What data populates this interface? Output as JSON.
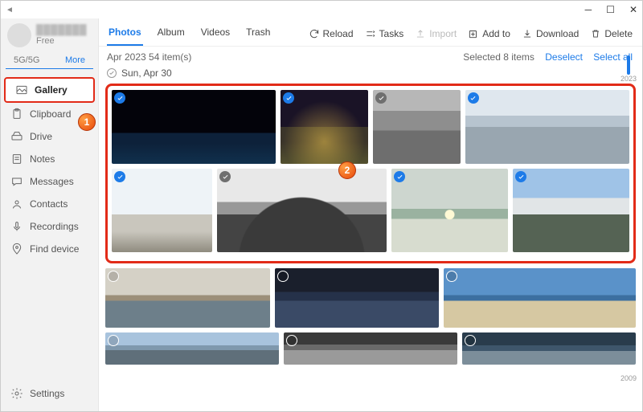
{
  "titlebar": {
    "sound_icon": "◄"
  },
  "user": {
    "name_placeholder": "███████",
    "plan": "Free",
    "network": "5G/5G",
    "more": "More"
  },
  "sidebar": {
    "items": [
      {
        "label": "Gallery"
      },
      {
        "label": "Clipboard"
      },
      {
        "label": "Drive"
      },
      {
        "label": "Notes"
      },
      {
        "label": "Messages"
      },
      {
        "label": "Contacts"
      },
      {
        "label": "Recordings"
      },
      {
        "label": "Find device"
      }
    ],
    "settings": "Settings"
  },
  "tabs": {
    "photos": "Photos",
    "album": "Album",
    "videos": "Videos",
    "trash": "Trash"
  },
  "actions": {
    "reload": "Reload",
    "tasks": "Tasks",
    "import": "Import",
    "addto": "Add to",
    "download": "Download",
    "delete": "Delete"
  },
  "status": {
    "summary": "Apr 2023 54 item(s)",
    "selected": "Selected 8 items",
    "deselect": "Deselect",
    "selectall": "Select all"
  },
  "date": {
    "label": "Sun, Apr 30"
  },
  "annotations": {
    "one": "1",
    "two": "2"
  },
  "timeline": {
    "top": "2023",
    "bottom": "2009"
  }
}
